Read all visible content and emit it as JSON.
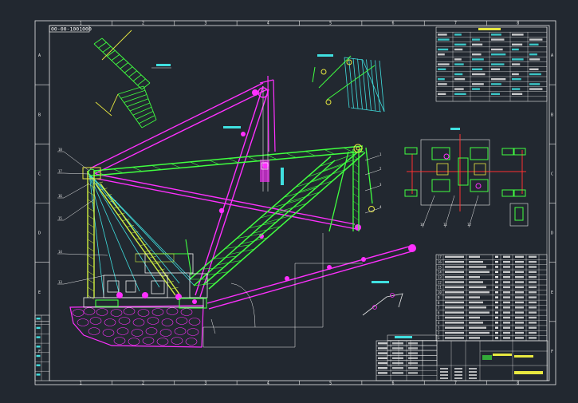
{
  "drawing": {
    "stamp_text": "00-00-1001000"
  },
  "border": {
    "zone_columns": [
      "1",
      "2",
      "3",
      "4",
      "5",
      "6",
      "7",
      "8"
    ],
    "zone_rows": [
      "A",
      "B",
      "C",
      "D",
      "E",
      "F"
    ]
  },
  "colors": {
    "background": "#222830",
    "frame": "#e8e8e8",
    "cyan": "#40e0e0",
    "green": "#40ff40",
    "magenta": "#ff30ff",
    "yellow": "#e8e840",
    "white": "#f0f0f0",
    "red": "#ff3030"
  },
  "parts_table": {
    "row_numbers": [
      "17",
      "16",
      "15",
      "14",
      "13",
      "12",
      "11",
      "10",
      "9",
      "8",
      "7",
      "6",
      "5",
      "4",
      "3",
      "2",
      "1"
    ]
  },
  "callouts": {
    "left_side": [
      "18",
      "17",
      "16",
      "15",
      "14",
      "13"
    ],
    "right_side": [
      "1",
      "2",
      "3",
      "4"
    ],
    "details": [
      "10",
      "11",
      "12"
    ]
  }
}
